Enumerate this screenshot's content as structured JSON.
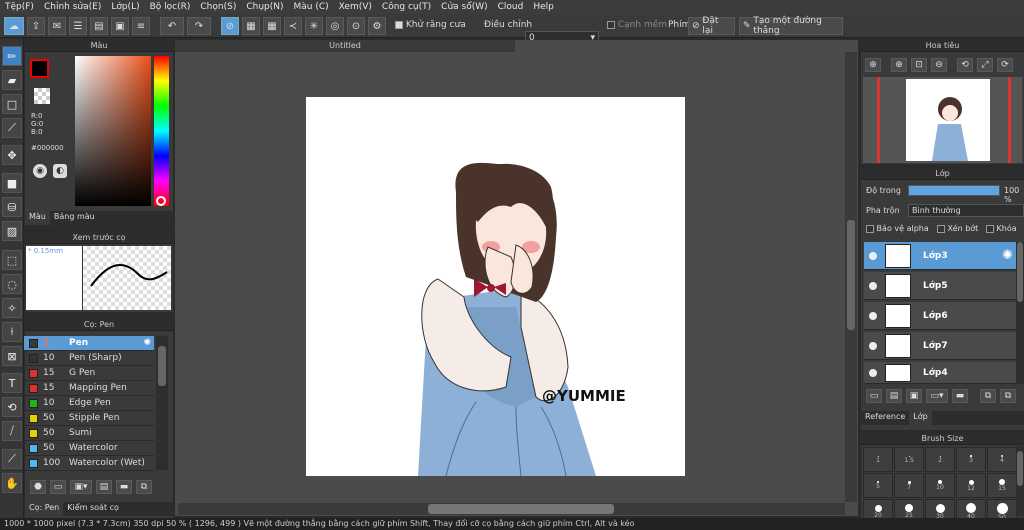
{
  "menu": [
    "Tệp(F)",
    "Chỉnh sửa(E)",
    "Lớp(L)",
    "Bộ lọc(R)",
    "Chọn(S)",
    "Chụp(N)",
    "Màu (C)",
    "Xem(V)",
    "Công cụ(T)",
    "Cửa sổ(W)",
    "Cloud",
    "Help"
  ],
  "toolbar": {
    "antialias_label": "Khử răng cưa",
    "adjust_label": "Điều chỉnh",
    "adjust_value": "0",
    "sharp_edge_label": "Cạnh mềm",
    "key_label": "Phím",
    "reset_label": "Đặt lại",
    "new_line_label": "Tạo một đường thẳng"
  },
  "color_panel": {
    "title": "Màu",
    "r": "R:0",
    "g": "G:0",
    "b": "B:0",
    "hex": "#000000",
    "tabs": [
      "Màu",
      "Bảng màu"
    ],
    "primary_color": "#000000"
  },
  "brush_preview": {
    "title": "Xem trước cọ",
    "size": "* 0.15mm"
  },
  "brush_panel": {
    "title": "Cọ: Pen",
    "items": [
      {
        "size": "2",
        "name": "Pen",
        "color": "#3a3a3a"
      },
      {
        "size": "10",
        "name": "Pen (Sharp)",
        "color": "#333333"
      },
      {
        "size": "15",
        "name": "G Pen",
        "color": "#e03030"
      },
      {
        "size": "15",
        "name": "Mapping Pen",
        "color": "#e03030"
      },
      {
        "size": "10",
        "name": "Edge Pen",
        "color": "#20b020"
      },
      {
        "size": "50",
        "name": "Stipple Pen",
        "color": "#e8d000"
      },
      {
        "size": "50",
        "name": "Sumi",
        "color": "#e8d000"
      },
      {
        "size": "50",
        "name": "Watercolor",
        "color": "#50b8f0"
      },
      {
        "size": "100",
        "name": "Watercolor (Wet)",
        "color": "#50b8f0"
      }
    ],
    "tabs": [
      "Cọ: Pen",
      "Kiểm soát cọ"
    ]
  },
  "canvas": {
    "tab": "Untitled",
    "watermark": "@YUMMIE"
  },
  "navigator": {
    "title": "Hoa tiêu"
  },
  "layer_panel": {
    "title": "Lớp",
    "opacity_label": "Độ trong",
    "opacity_value": "100 %",
    "opacity_fraction": 1.0,
    "blend_label": "Pha trộn",
    "blend_value": "Bình thường",
    "protect_alpha": "Bảo vệ alpha",
    "clipping": "Xén bớt",
    "lock": "Khóa",
    "layers": [
      "Lớp3",
      "Lớp5",
      "Lớp6",
      "Lớp7",
      "Lớp4"
    ],
    "tabs": [
      "Reference",
      "Lớp"
    ]
  },
  "brush_size": {
    "title": "Brush Size",
    "labels": [
      "1",
      "1.5",
      "2",
      "3",
      "4",
      "5",
      "7",
      "10",
      "12",
      "15",
      "20",
      "25",
      "30",
      "40",
      "50"
    ]
  },
  "status": "1000 * 1000 pixel   (7.3 * 7.3cm)   350 dpi   50 %   ( 1296, 499 )   Vẽ một đường thẳng bằng cách giữ phím Shift, Thay đổi cỡ cọ bằng cách giữ phím Ctrl, Alt và kéo"
}
